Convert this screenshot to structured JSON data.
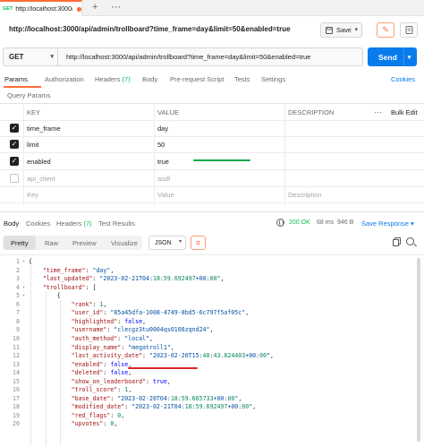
{
  "tabstrip": {
    "active_tab": {
      "method": "GET",
      "title": "http://localhost:3000/a"
    },
    "add_label": "+",
    "more_label": "⋯"
  },
  "request": {
    "title": "http://localhost:3000/api/admin/trollboard?time_frame=day&limit=50&enabled=true",
    "save_label": "Save",
    "method": "GET",
    "url": "http://localhost:3000/api/admin/trollboard?time_frame=day&limit=50&enabled=true",
    "send_label": "Send"
  },
  "request_tabs": [
    {
      "label": "Params",
      "count": ""
    },
    {
      "label": "Authorization",
      "count": ""
    },
    {
      "label": "Headers",
      "count": "(7)"
    },
    {
      "label": "Body",
      "count": ""
    },
    {
      "label": "Pre-request Script",
      "count": ""
    },
    {
      "label": "Tests",
      "count": ""
    },
    {
      "label": "Settings",
      "count": ""
    }
  ],
  "cookies_label": "Cookies",
  "query_params_label": "Query Params",
  "params_table": {
    "headers": [
      "KEY",
      "VALUE",
      "DESCRIPTION"
    ],
    "more_label": "⋯",
    "bulk_edit_label": "Bulk Edit",
    "rows": [
      {
        "checked": true,
        "key": "time_frame",
        "value": "day"
      },
      {
        "checked": true,
        "key": "limit",
        "value": "50"
      },
      {
        "checked": true,
        "key": "enabled",
        "value": "true"
      },
      {
        "checked": false,
        "key": "api_client",
        "value": "asdf"
      }
    ],
    "placeholder": {
      "key": "Key",
      "value": "Value",
      "description": "Description"
    }
  },
  "response": {
    "tabs": [
      {
        "label": "Body",
        "count": ""
      },
      {
        "label": "Cookies",
        "count": ""
      },
      {
        "label": "Headers",
        "count": "(7)"
      },
      {
        "label": "Test Results",
        "count": ""
      }
    ],
    "status": "200 OK",
    "time": "68 ms",
    "size": "946 B",
    "save_response_label": "Save Response",
    "formats": [
      "Pretty",
      "Raw",
      "Preview",
      "Visualize"
    ],
    "language": "JSON"
  },
  "code_lines": [
    {
      "n": "1",
      "text": "{"
    },
    {
      "n": "2",
      "text": "    \"time_frame\": \"day\","
    },
    {
      "n": "3",
      "text": "    \"last_updated\": \"2023-02-21T04:18:59.692497+00:00\","
    },
    {
      "n": "4",
      "text": "    \"trollboard\": ["
    },
    {
      "n": "5",
      "text": "        {"
    },
    {
      "n": "6",
      "text": "            \"rank\": 1,"
    },
    {
      "n": "7",
      "text": "            \"user_id\": \"85a45dfa-1008-4749-8bd5-6c797f5af05c\","
    },
    {
      "n": "8",
      "text": "            \"highlighted\": false,"
    },
    {
      "n": "9",
      "text": "            \"username\": \"clecgz3tu0004qs0108zqnd24\","
    },
    {
      "n": "10",
      "text": "            \"auth_method\": \"local\","
    },
    {
      "n": "11",
      "text": "            \"display_name\": \"megatroll1\","
    },
    {
      "n": "12",
      "text": "            \"last_activity_date\": \"2023-02-20T15:40:43.824403+00:00\","
    },
    {
      "n": "13",
      "text": "            \"enabled\": false,"
    },
    {
      "n": "14",
      "text": "            \"deleted\": false,"
    },
    {
      "n": "15",
      "text": "            \"show_on_leaderboard\": true,"
    },
    {
      "n": "16",
      "text": "            \"troll_score\": 1,"
    },
    {
      "n": "17",
      "text": "            \"base_date\": \"2023-02-20T04:18:59.665733+00:00\","
    },
    {
      "n": "18",
      "text": "            \"modified_date\": \"2023-02-21T04:18:59.692497+00:00\","
    },
    {
      "n": "19",
      "text": "            \"red_flags\": 0,"
    },
    {
      "n": "20",
      "text": "            \"upvotes\": 0,"
    }
  ],
  "colors": {
    "accent": "#ff6c37",
    "send": "#097bed",
    "success": "#0cbb52",
    "annotation_green": "#18a84a",
    "annotation_red": "#d9262c"
  }
}
